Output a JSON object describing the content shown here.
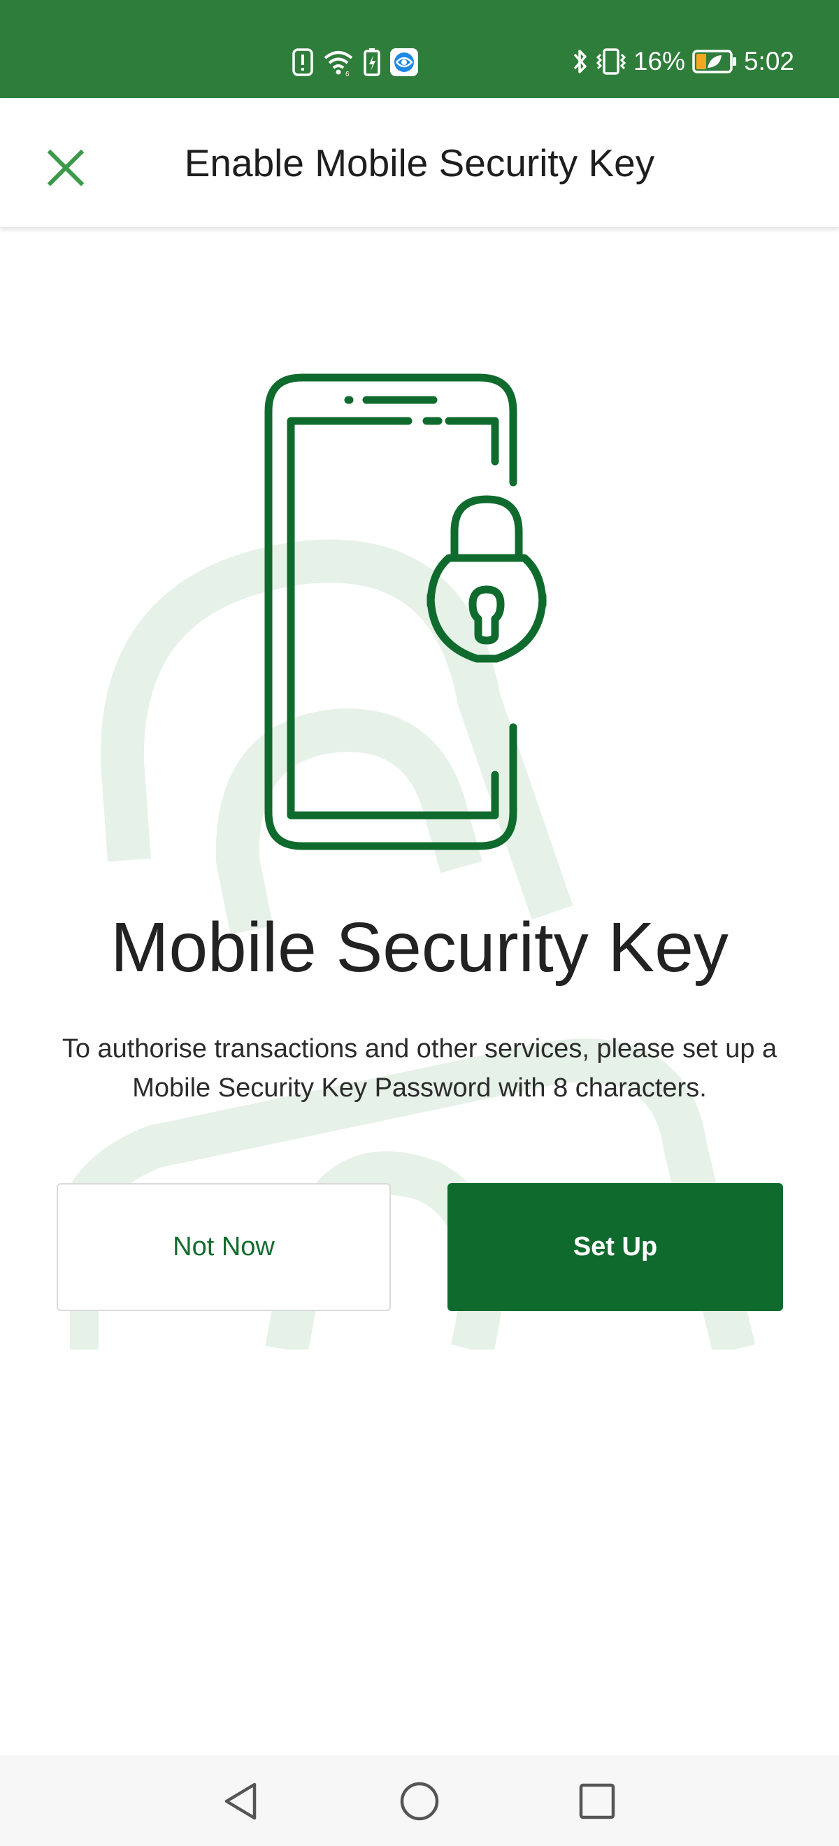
{
  "status_bar": {
    "battery_percent": "16%",
    "time": "5:02",
    "background_color": "#2e7d3a",
    "left_icons": [
      "notification-alert-icon",
      "wifi-icon",
      "battery-saver-icon",
      "app-notification-icon"
    ],
    "right_icons": [
      "bluetooth-icon",
      "vibrate-icon",
      "battery-icon"
    ]
  },
  "header": {
    "title": "Enable Mobile Security Key",
    "close_icon": "close-icon",
    "close_color": "#3a9a4a"
  },
  "illustration": {
    "icon": "phone-with-padlock-icon",
    "stroke_color": "#0f6b2d",
    "watermark_color": "#e6f1e8"
  },
  "content": {
    "heading": "Mobile Security Key",
    "description": "To authorise transactions and other services, please set up a Mobile Security Key Password with 8 characters."
  },
  "buttons": {
    "not_now": "Not Now",
    "set_up": "Set Up",
    "primary_color": "#0f6b2d"
  },
  "nav_bar": {
    "items": [
      "back-icon",
      "home-icon",
      "recents-icon"
    ]
  }
}
